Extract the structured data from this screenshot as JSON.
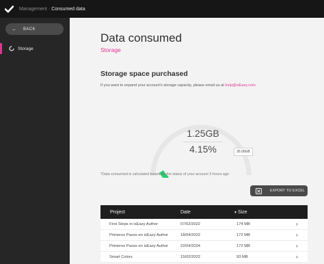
{
  "topbar": {
    "breadcrumb_parent": "Management",
    "breadcrumb_separator": "·",
    "breadcrumb_current": "Consumed data"
  },
  "sidebar": {
    "back_label": "BACK",
    "items": [
      {
        "label": "Storage",
        "active": true
      }
    ]
  },
  "main": {
    "title": "Data consumed",
    "subtitle": "Storage",
    "section_title": "Storage space purchased",
    "section_desc": "If you want to expand your account's storage capacity, please email us at ",
    "section_email": "help@isEazy.com",
    "section_desc_end": "."
  },
  "gauge": {
    "used": "1.25GB",
    "percent": "4.15%",
    "fraction": 0.0415,
    "max": "30.00GB",
    "note": "*Data consumed is calculated based on the status of your account 3 hours ago"
  },
  "export_label": "EXPORT TO EXCEL",
  "table": {
    "headers": {
      "project": "Project",
      "date": "Date",
      "size": "Size"
    },
    "rows": [
      {
        "project": "First Steps in isEazy Author",
        "date": "07/02/2022",
        "size": "174 MB"
      },
      {
        "project": "Primeros Pasos en isEazy Author",
        "date": "18/04/2022",
        "size": "172 MB"
      },
      {
        "project": "Primeros Pasos en isEazy Author",
        "date": "22/04/2024",
        "size": "172 MB"
      },
      {
        "project": "Smart Colors",
        "date": "15/02/2022",
        "size": "93 MB"
      }
    ]
  },
  "colors": {
    "accent": "#e0338f",
    "gauge_fill": "#2ecc71",
    "topbar": "#161616",
    "sidebar": "#262626"
  },
  "icons": {
    "logo": "checkmark-logo-icon",
    "back": "arrow-left-icon",
    "storage": "ring-icon",
    "export": "excel-icon",
    "row": "chevron-right-icon",
    "sort": "caret-down-icon"
  }
}
